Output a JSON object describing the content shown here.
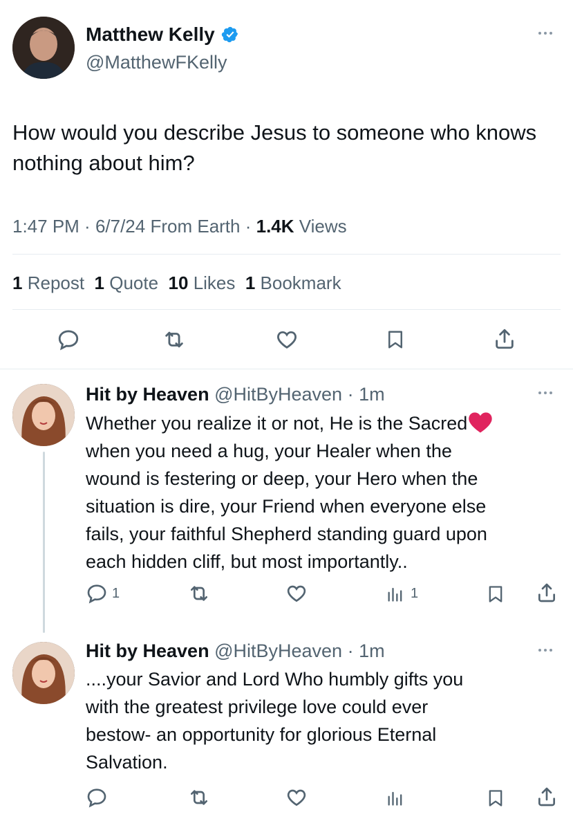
{
  "main_tweet": {
    "author_name": "Matthew Kelly",
    "author_handle": "@MatthewFKelly",
    "text": "How would you describe Jesus to someone who knows nothing about him?",
    "time": "1:47 PM",
    "sep1": " · ",
    "date": "6/7/24",
    "source": "From Earth",
    "sep2": " · ",
    "views_count": "1.4K",
    "views_label": "Views",
    "stats": {
      "reposts_count": "1",
      "reposts_label": "Repost",
      "quotes_count": "1",
      "quotes_label": "Quote",
      "likes_count": "10",
      "likes_label": "Likes",
      "bookmarks_count": "1",
      "bookmarks_label": "Bookmark"
    }
  },
  "replies": [
    {
      "author_name": "Hit by Heaven",
      "author_handle": "@HitByHeaven",
      "sep": " · ",
      "time": "1m",
      "text": "Whether you realize it or not, He is the Sacred",
      "text_rest": "when you need a hug, your Healer when the\nwound is festering or deep, your Hero when the\nsituation is dire, your Friend when everyone else\nfails, your faithful Shepherd standing guard upon\neach hidden cliff, but most importantly..",
      "reply_count": "1",
      "views_count": "1"
    },
    {
      "author_name": "Hit by Heaven",
      "author_handle": "@HitByHeaven",
      "sep": " · ",
      "time": "1m",
      "text": "....your Savior and Lord Who humbly gifts you\nwith the greatest privilege love could ever\nbestow- an opportunity for glorious Eternal\nSalvation."
    }
  ],
  "colors": {
    "verified": "#1d9bf0",
    "heart": "#e0245e",
    "muted": "#536471"
  },
  "icons": [
    "verified-badge-icon",
    "more-icon",
    "reply-icon",
    "repost-icon",
    "like-icon",
    "bookmark-icon",
    "share-icon",
    "views-icon",
    "heart-emoji-icon"
  ]
}
